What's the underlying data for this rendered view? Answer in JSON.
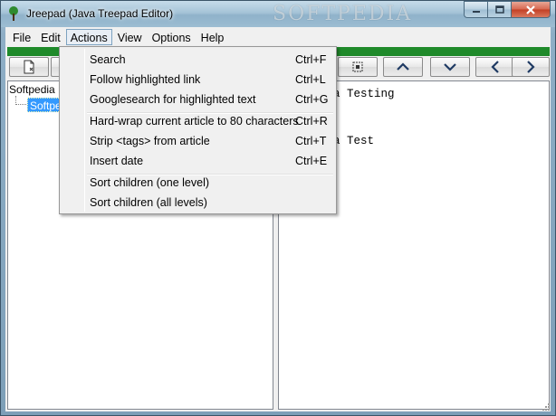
{
  "window": {
    "title": "Jreepad (Java Treepad Editor)",
    "watermark": "SOFTPEDIA"
  },
  "menubar": [
    {
      "label": "File"
    },
    {
      "label": "Edit"
    },
    {
      "label": "Actions"
    },
    {
      "label": "View"
    },
    {
      "label": "Options"
    },
    {
      "label": "Help"
    }
  ],
  "actions_menu": {
    "groups": [
      [
        {
          "label": "Search",
          "shortcut": "Ctrl+F"
        },
        {
          "label": "Follow highlighted link",
          "shortcut": "Ctrl+L"
        },
        {
          "label": "Googlesearch for highlighted text",
          "shortcut": "Ctrl+G"
        }
      ],
      [
        {
          "label": "Hard-wrap current article to 80 characters",
          "shortcut": "Ctrl+R"
        },
        {
          "label": "Strip <tags> from article",
          "shortcut": "Ctrl+T"
        },
        {
          "label": "Insert date",
          "shortcut": "Ctrl+E"
        }
      ],
      [
        {
          "label": "Sort children (one level)",
          "shortcut": ""
        },
        {
          "label": "Sort children (all levels)",
          "shortcut": ""
        }
      ]
    ]
  },
  "tree": {
    "root": "Softpedia",
    "child": "Softped"
  },
  "article": {
    "line1": "a Testing",
    "line2": "a Test"
  },
  "colors": {
    "accent_green": "#1f8a2a",
    "selection": "#3399ff"
  }
}
